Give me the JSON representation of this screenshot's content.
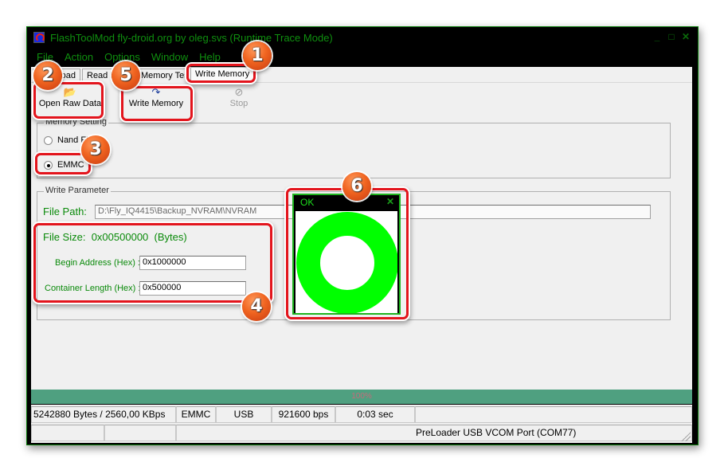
{
  "window": {
    "title": "FlashToolMod fly-droid.org by oleg.svs (Runtime Trace Mode)",
    "controls": {
      "minimize": "_",
      "maximize": "□",
      "close": "✕"
    }
  },
  "menu": [
    "File",
    "Action",
    "Options",
    "Window",
    "Help"
  ],
  "tabs": [
    {
      "label": "Download",
      "visible_text": "oad"
    },
    {
      "label": "Read back",
      "visible_text": "Read b"
    },
    {
      "label": "Memory Test",
      "visible_text": "Memory Test"
    },
    {
      "label": "Write Memory",
      "visible_text": "Write Memory",
      "active": true
    }
  ],
  "toolbar": {
    "open_raw_data": {
      "label": "Open Raw Data",
      "icon": "folder-open-icon"
    },
    "write_memory": {
      "label": "Write Memory",
      "icon": "redo-arrow-icon"
    },
    "stop": {
      "label": "Stop",
      "icon": "stop-icon",
      "disabled": true
    }
  },
  "memory_setting": {
    "title": "Memory Setting",
    "options": [
      {
        "label": "Nand Flash",
        "visible_text": "Nand Fl",
        "checked": false
      },
      {
        "label": "EMMC",
        "checked": true
      }
    ]
  },
  "write_parameter": {
    "title": "Write Parameter",
    "file_path_label": "File Path:",
    "file_path_value": "D:\\Fly_IQ4415\\Backup_NVRAM\\NVRAM",
    "file_size_label": "File Size:",
    "file_size_value": "0x00500000",
    "file_size_unit": "(Bytes)",
    "begin_address_label": "Begin Address (Hex) :",
    "begin_address_value": "0x1000000",
    "container_length_label": "Container Length (Hex) :",
    "container_length_value": "0x500000"
  },
  "popup": {
    "title": "OK",
    "close": "✕",
    "result": "success"
  },
  "progress": {
    "percent": 100,
    "label": "100%"
  },
  "status": {
    "row1": [
      "5242880 Bytes / 2560,00 KBps",
      "EMMC",
      "USB",
      "921600 bps",
      "0:03 sec",
      ""
    ],
    "row2": [
      "",
      "",
      "PreLoader USB VCOM Port (COM77)"
    ]
  },
  "callouts": [
    "1",
    "2",
    "3",
    "4",
    "5",
    "6"
  ],
  "colors": {
    "title_green": "#0f8f0f",
    "label_green": "#0a8a0a",
    "progress_fill": "#4fa080",
    "highlight_red": "#e3141c",
    "ok_ring": "#00ff00"
  }
}
